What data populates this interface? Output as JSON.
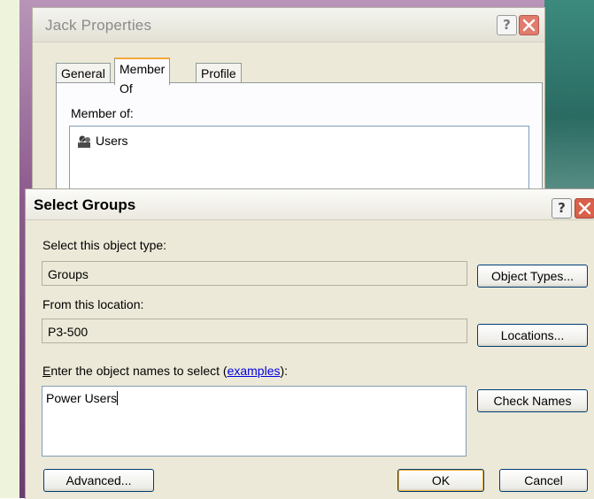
{
  "back_window": {
    "title": "Jack Properties",
    "help_label": "?",
    "close_label": "×",
    "tabs": [
      {
        "label": "General"
      },
      {
        "label": "Member Of"
      },
      {
        "label": "Profile"
      }
    ],
    "member_of_label": "Member of:",
    "members": [
      {
        "name": "Users"
      }
    ]
  },
  "dialog": {
    "title": "Select Groups",
    "help_label": "?",
    "close_label": "×",
    "object_type_label": "Select this object type:",
    "object_type_value": "Groups",
    "object_types_button": "Object Types...",
    "location_label": "From this location:",
    "location_value": "P3-500",
    "locations_button": "Locations...",
    "names_label_prefix": "nter the object names to select (",
    "names_label_first_letter": "E",
    "names_label_link": "examples",
    "names_label_suffix": "):",
    "names_value": "Power Users",
    "check_names_button": "Check Names",
    "advanced_button": "Advanced...",
    "ok_button": "OK",
    "cancel_button": "Cancel"
  },
  "colors": {
    "desktop_bg": "#8c5a8d",
    "window_face": "#ece9d8",
    "close_red": "#d9604b",
    "link_blue": "#0000e0"
  }
}
